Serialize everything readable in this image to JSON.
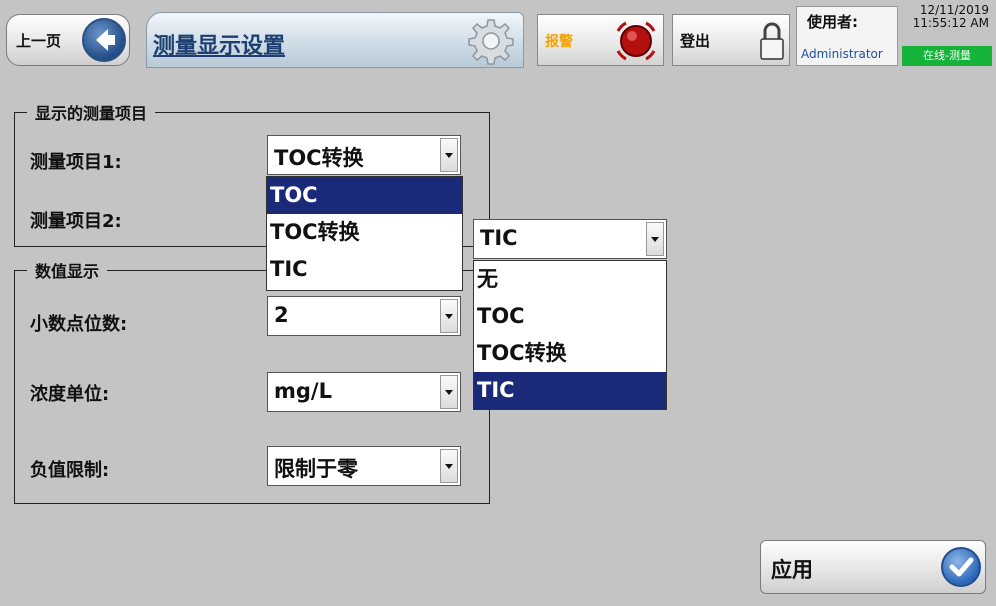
{
  "header": {
    "back_label": "上一页",
    "title": "测量显示设置",
    "alarm_label": "报警",
    "logout_label": "登出",
    "user_label": "使用者:",
    "user_name": "Administrator",
    "date": "12/11/2019",
    "time": "11:55:12 AM",
    "status": "在线-测量"
  },
  "group_measure": {
    "legend": "显示的测量项目",
    "item1_label": "测量项目1:",
    "item1_value": "TOC转换",
    "item1_options": [
      "TOC",
      "TOC转换",
      "TIC"
    ],
    "item1_selected_index": 0,
    "item2_label": "测量项目2:",
    "item2_value": "TIC",
    "item2_options": [
      "无",
      "TOC",
      "TOC转换",
      "TIC"
    ],
    "item2_selected_index": 3
  },
  "group_numeric": {
    "legend": "数值显示",
    "decimals_label": "小数点位数:",
    "decimals_value": "2",
    "unit_label": "浓度单位:",
    "unit_value": "mg/L",
    "negative_label": "负值限制:",
    "negative_value": "限制于零"
  },
  "apply_label": "应用",
  "colors": {
    "background": "#c4c4c4",
    "selected_option": "#1a2a78",
    "status_badge": "#15b33a",
    "alarm_text": "#f3a200",
    "title_text": "#1d3f70"
  },
  "icons": {
    "back": "left-arrow-icon",
    "settings": "gear-icon",
    "alarm": "alarm-icon",
    "logout": "lock-icon",
    "apply": "checkmark-icon"
  }
}
